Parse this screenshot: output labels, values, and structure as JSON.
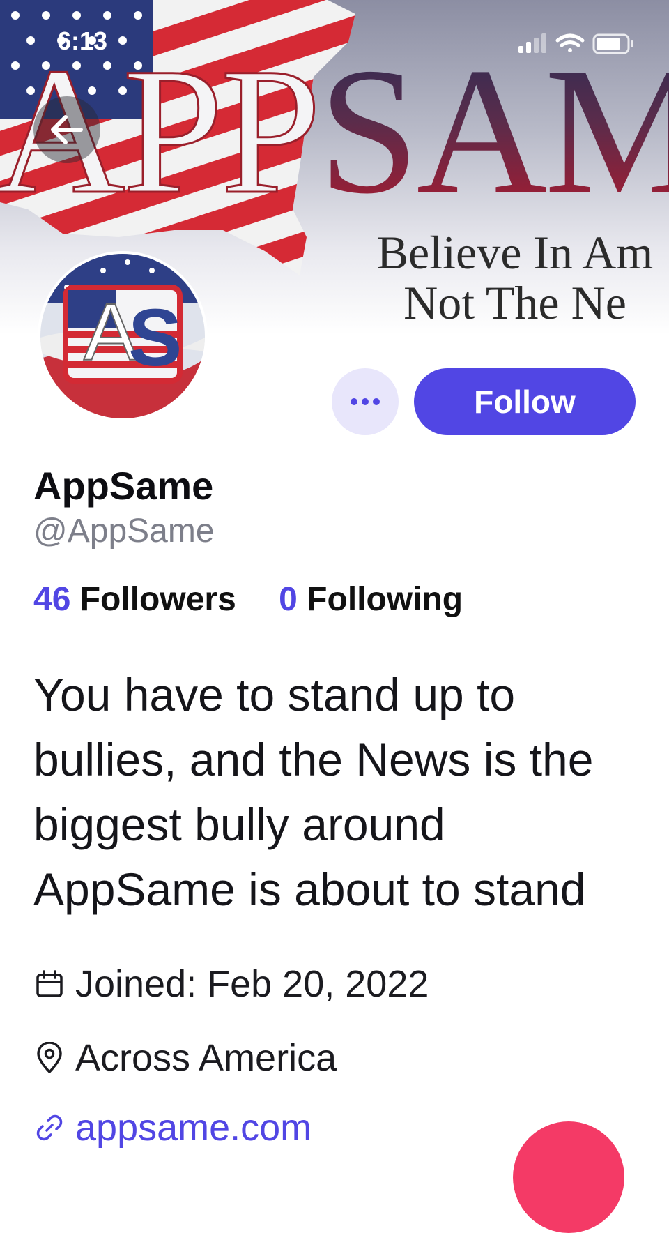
{
  "status_bar": {
    "time": "6:13"
  },
  "banner": {
    "wordmark_left": "APP",
    "wordmark_right": "SAM",
    "tagline_line1": "Believe In Am",
    "tagline_line2": "Not The Ne"
  },
  "avatar": {
    "letter_a": "A",
    "letter_s": "S"
  },
  "actions": {
    "follow_label": "Follow"
  },
  "profile": {
    "display_name": "AppSame",
    "handle": "@AppSame",
    "followers_count": "46",
    "followers_label": "Followers",
    "following_count": "0",
    "following_label": "Following",
    "bio": "You have to stand up to bullies, and the News is the biggest bully around AppSame is about to stand",
    "joined": "Joined: Feb 20, 2022",
    "location": "Across America",
    "website": "appsame.com"
  },
  "icons": {
    "back": "arrow-left-icon",
    "more": "ellipsis-icon",
    "calendar": "calendar-icon",
    "location": "map-pin-icon",
    "link": "link-icon"
  },
  "colors": {
    "accent": "#5146e4",
    "accent_light": "#e8e6fb",
    "fab": "#f43a66",
    "muted_text": "#7d7f8a"
  }
}
